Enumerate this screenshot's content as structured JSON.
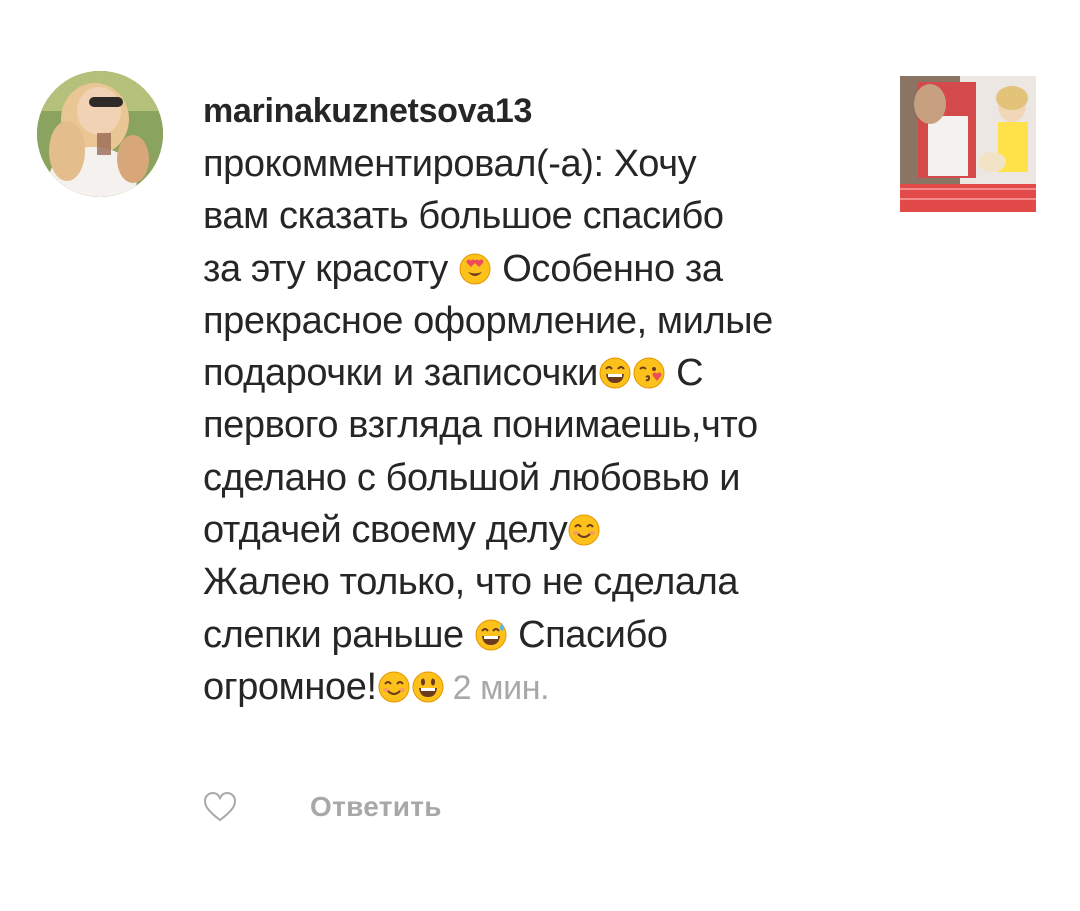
{
  "notification": {
    "username": "marinakuznetsova13",
    "comment_lines": [
      {
        "text": "прокомментировал(-а): Хочу"
      },
      {
        "text": "вам сказать большое спасибо"
      },
      {
        "text_before": "за эту красоту ",
        "emojis": [
          "heart-eyes-emoji"
        ],
        "text_after": " Особенно за"
      },
      {
        "text": "прекрасное оформление, милые"
      },
      {
        "text_before": "подарочки и записочки",
        "emojis": [
          "grinning-squint-emoji",
          "kissing-heart-emoji"
        ],
        "text_after": " С"
      },
      {
        "text": "первого взгляда понимаешь,что"
      },
      {
        "text": "сделано с большой любовью и"
      },
      {
        "text_before": "отдачей своему делу",
        "emojis": [
          "smiling-blush-emoji"
        ],
        "text_after": ""
      },
      {
        "text": "Жалею только, что не сделала"
      },
      {
        "text_before": "слепки раньше ",
        "emojis": [
          "sweat-smile-emoji"
        ],
        "text_after": " Спасибо"
      },
      {
        "text_before": "огромное!",
        "emojis": [
          "smiling-blush-emoji",
          "grinning-emoji"
        ],
        "text_after": ""
      }
    ],
    "timestamp": "2 мин.",
    "avatar_icon": "user-avatar",
    "thumbnail_icon": "post-thumbnail",
    "like_icon": "heart-outline-icon",
    "reply_label": "Ответить"
  },
  "colors": {
    "text": "#262626",
    "secondary": "#a8a8a8",
    "background": "#ffffff",
    "emoji_face": "#fcc21b",
    "emoji_outline": "#e59600",
    "heart_red": "#ed4c5c"
  }
}
